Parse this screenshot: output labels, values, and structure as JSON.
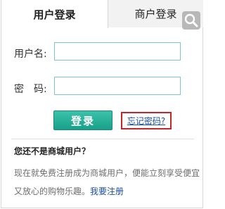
{
  "tabs": {
    "active_label": "用户登录",
    "inactive_label": "商户登录"
  },
  "form": {
    "username_label": "用户名:",
    "password_label": "密　码:",
    "username_value": "",
    "password_value": ""
  },
  "actions": {
    "login_label": "登录",
    "forgot_label": "忘记密码?"
  },
  "register": {
    "question": "您还不是商城用户？",
    "description": "现在就免费注册成为商城用户，便能立刻享受便宜又放心的购物乐趣。",
    "link_label": "我要注册"
  },
  "icons": {
    "corner": "search-zoom-icon"
  },
  "colors": {
    "accent_teal": "#17a08a",
    "input_border": "#7fc6c9",
    "forgot_border": "#c0282a",
    "link": "#1a4f9c"
  }
}
